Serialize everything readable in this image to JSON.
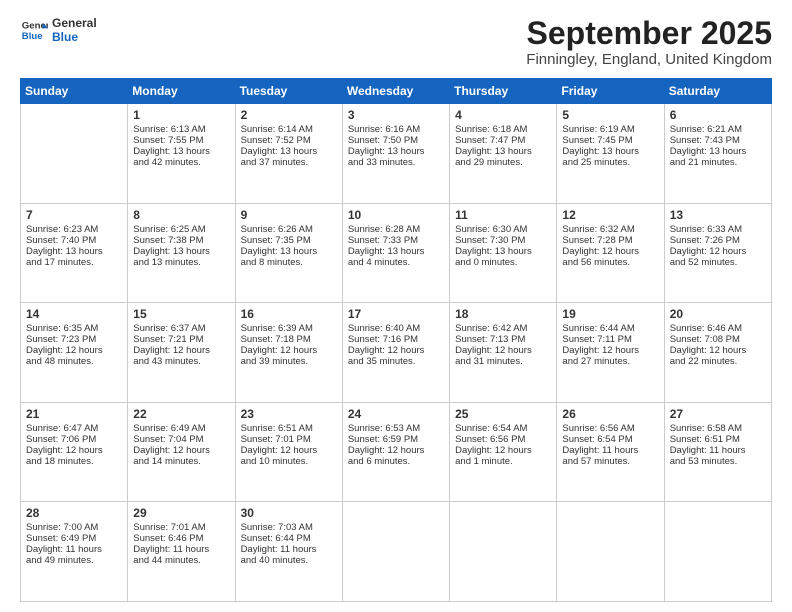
{
  "logo": {
    "line1": "General",
    "line2": "Blue"
  },
  "title": "September 2025",
  "location": "Finningley, England, United Kingdom",
  "days_header": [
    "Sunday",
    "Monday",
    "Tuesday",
    "Wednesday",
    "Thursday",
    "Friday",
    "Saturday"
  ],
  "weeks": [
    [
      {
        "day": "",
        "text": ""
      },
      {
        "day": "1",
        "text": "Sunrise: 6:13 AM\nSunset: 7:55 PM\nDaylight: 13 hours\nand 42 minutes."
      },
      {
        "day": "2",
        "text": "Sunrise: 6:14 AM\nSunset: 7:52 PM\nDaylight: 13 hours\nand 37 minutes."
      },
      {
        "day": "3",
        "text": "Sunrise: 6:16 AM\nSunset: 7:50 PM\nDaylight: 13 hours\nand 33 minutes."
      },
      {
        "day": "4",
        "text": "Sunrise: 6:18 AM\nSunset: 7:47 PM\nDaylight: 13 hours\nand 29 minutes."
      },
      {
        "day": "5",
        "text": "Sunrise: 6:19 AM\nSunset: 7:45 PM\nDaylight: 13 hours\nand 25 minutes."
      },
      {
        "day": "6",
        "text": "Sunrise: 6:21 AM\nSunset: 7:43 PM\nDaylight: 13 hours\nand 21 minutes."
      }
    ],
    [
      {
        "day": "7",
        "text": "Sunrise: 6:23 AM\nSunset: 7:40 PM\nDaylight: 13 hours\nand 17 minutes."
      },
      {
        "day": "8",
        "text": "Sunrise: 6:25 AM\nSunset: 7:38 PM\nDaylight: 13 hours\nand 13 minutes."
      },
      {
        "day": "9",
        "text": "Sunrise: 6:26 AM\nSunset: 7:35 PM\nDaylight: 13 hours\nand 8 minutes."
      },
      {
        "day": "10",
        "text": "Sunrise: 6:28 AM\nSunset: 7:33 PM\nDaylight: 13 hours\nand 4 minutes."
      },
      {
        "day": "11",
        "text": "Sunrise: 6:30 AM\nSunset: 7:30 PM\nDaylight: 13 hours\nand 0 minutes."
      },
      {
        "day": "12",
        "text": "Sunrise: 6:32 AM\nSunset: 7:28 PM\nDaylight: 12 hours\nand 56 minutes."
      },
      {
        "day": "13",
        "text": "Sunrise: 6:33 AM\nSunset: 7:26 PM\nDaylight: 12 hours\nand 52 minutes."
      }
    ],
    [
      {
        "day": "14",
        "text": "Sunrise: 6:35 AM\nSunset: 7:23 PM\nDaylight: 12 hours\nand 48 minutes."
      },
      {
        "day": "15",
        "text": "Sunrise: 6:37 AM\nSunset: 7:21 PM\nDaylight: 12 hours\nand 43 minutes."
      },
      {
        "day": "16",
        "text": "Sunrise: 6:39 AM\nSunset: 7:18 PM\nDaylight: 12 hours\nand 39 minutes."
      },
      {
        "day": "17",
        "text": "Sunrise: 6:40 AM\nSunset: 7:16 PM\nDaylight: 12 hours\nand 35 minutes."
      },
      {
        "day": "18",
        "text": "Sunrise: 6:42 AM\nSunset: 7:13 PM\nDaylight: 12 hours\nand 31 minutes."
      },
      {
        "day": "19",
        "text": "Sunrise: 6:44 AM\nSunset: 7:11 PM\nDaylight: 12 hours\nand 27 minutes."
      },
      {
        "day": "20",
        "text": "Sunrise: 6:46 AM\nSunset: 7:08 PM\nDaylight: 12 hours\nand 22 minutes."
      }
    ],
    [
      {
        "day": "21",
        "text": "Sunrise: 6:47 AM\nSunset: 7:06 PM\nDaylight: 12 hours\nand 18 minutes."
      },
      {
        "day": "22",
        "text": "Sunrise: 6:49 AM\nSunset: 7:04 PM\nDaylight: 12 hours\nand 14 minutes."
      },
      {
        "day": "23",
        "text": "Sunrise: 6:51 AM\nSunset: 7:01 PM\nDaylight: 12 hours\nand 10 minutes."
      },
      {
        "day": "24",
        "text": "Sunrise: 6:53 AM\nSunset: 6:59 PM\nDaylight: 12 hours\nand 6 minutes."
      },
      {
        "day": "25",
        "text": "Sunrise: 6:54 AM\nSunset: 6:56 PM\nDaylight: 12 hours\nand 1 minute."
      },
      {
        "day": "26",
        "text": "Sunrise: 6:56 AM\nSunset: 6:54 PM\nDaylight: 11 hours\nand 57 minutes."
      },
      {
        "day": "27",
        "text": "Sunrise: 6:58 AM\nSunset: 6:51 PM\nDaylight: 11 hours\nand 53 minutes."
      }
    ],
    [
      {
        "day": "28",
        "text": "Sunrise: 7:00 AM\nSunset: 6:49 PM\nDaylight: 11 hours\nand 49 minutes."
      },
      {
        "day": "29",
        "text": "Sunrise: 7:01 AM\nSunset: 6:46 PM\nDaylight: 11 hours\nand 44 minutes."
      },
      {
        "day": "30",
        "text": "Sunrise: 7:03 AM\nSunset: 6:44 PM\nDaylight: 11 hours\nand 40 minutes."
      },
      {
        "day": "",
        "text": ""
      },
      {
        "day": "",
        "text": ""
      },
      {
        "day": "",
        "text": ""
      },
      {
        "day": "",
        "text": ""
      }
    ]
  ]
}
